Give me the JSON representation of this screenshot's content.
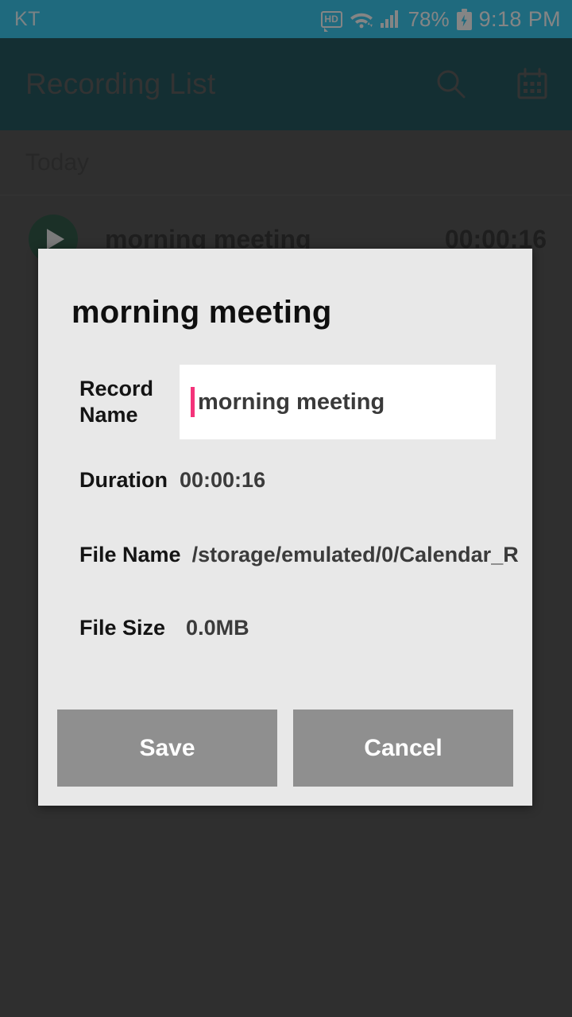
{
  "status_bar": {
    "carrier": "KT",
    "hd_label": "HD",
    "battery_percent": "78%",
    "clock": "9:18 PM",
    "background_color": "#1EC3F0",
    "icons": [
      "hd-icon",
      "wifi-icon",
      "signal-icon",
      "battery-charging-icon"
    ]
  },
  "app_bar": {
    "title": "Recording List",
    "background_color": "#05404A",
    "actions": [
      {
        "name": "search-icon",
        "label": "Search"
      },
      {
        "name": "calendar-icon",
        "label": "Calendar"
      }
    ]
  },
  "recording_list": {
    "section_header": "Today",
    "items": [
      {
        "name": "morning meeting",
        "duration": "00:00:16",
        "play_icon": "play-icon"
      }
    ]
  },
  "dialog": {
    "title": "morning meeting",
    "background_color": "#e8e8e8",
    "fields": [
      {
        "label": "Record Name",
        "value": "morning meeting",
        "type": "input"
      },
      {
        "label": "Duration",
        "value": "00:00:16",
        "type": "text"
      },
      {
        "label": "File Name",
        "value": "/storage/emulated/0/Calendar_R",
        "type": "text"
      },
      {
        "label": "File Size",
        "value": "0.0MB",
        "type": "text"
      }
    ],
    "record_name": {
      "label_line1": "Record",
      "label_line2": "Name",
      "value": "morning meeting",
      "caret_color": "#F4337A"
    },
    "duration": {
      "label": "Duration",
      "value": "00:00:16"
    },
    "file_name": {
      "label": "File Name",
      "value": "/storage/emulated/0/Calendar_R"
    },
    "file_size": {
      "label": "File Size",
      "value": "0.0MB"
    },
    "buttons": {
      "save": "Save",
      "cancel": "Cancel",
      "color": "#8f8f8f"
    }
  }
}
